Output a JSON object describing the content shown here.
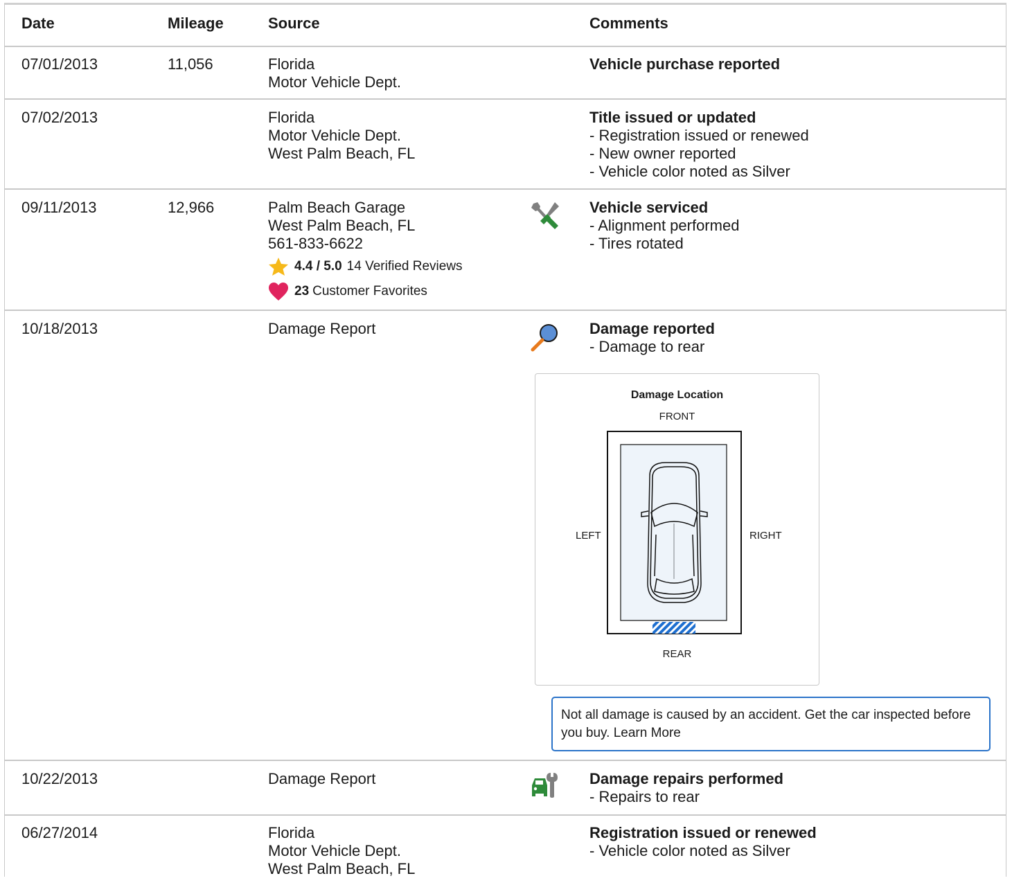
{
  "headers": {
    "date": "Date",
    "mileage": "Mileage",
    "source": "Source",
    "comments": "Comments"
  },
  "rows": [
    {
      "date": "07/01/2013",
      "mileage": "11,056",
      "source": [
        "Florida",
        "Motor Vehicle Dept."
      ],
      "title": "Vehicle purchase reported",
      "items": []
    },
    {
      "date": "07/02/2013",
      "mileage": "",
      "source": [
        "Florida",
        "Motor Vehicle Dept.",
        "West Palm Beach, FL"
      ],
      "title": "Title issued or updated",
      "items": [
        "- Registration issued or renewed",
        "- New owner reported",
        "- Vehicle color noted as Silver"
      ]
    },
    {
      "date": "09/11/2013",
      "mileage": "12,966",
      "source": [
        "Palm Beach Garage",
        "West Palm Beach, FL",
        "561-833-6622"
      ],
      "rating": "4.4 / 5.0",
      "reviews": "14 Verified Reviews",
      "favorites_count": "23",
      "favorites_label": "Customer Favorites",
      "icon": "wrench-screwdriver-icon",
      "title": "Vehicle serviced",
      "items": [
        "- Alignment performed",
        "- Tires rotated"
      ]
    },
    {
      "date": "10/18/2013",
      "mileage": "",
      "source": [
        "Damage Report"
      ],
      "icon": "magnifier-icon",
      "title": "Damage reported",
      "items": [
        "- Damage to rear"
      ]
    },
    {
      "date": "10/22/2013",
      "mileage": "",
      "source": [
        "Damage Report"
      ],
      "icon": "car-repair-icon",
      "title": "Damage repairs performed",
      "items": [
        "- Repairs to rear"
      ]
    },
    {
      "date": "06/27/2014",
      "mileage": "",
      "source": [
        "Florida",
        "Motor Vehicle Dept.",
        "West Palm Beach, FL"
      ],
      "title": "Registration issued or renewed",
      "items": [
        "- Vehicle color noted as Silver"
      ]
    }
  ],
  "damage": {
    "title": "Damage Location",
    "front": "FRONT",
    "rear": "REAR",
    "left": "LEFT",
    "right": "RIGHT",
    "damaged_area": "rear"
  },
  "notice": "Not all damage is caused by an accident. Get the car inspected before you buy. Learn More",
  "colors": {
    "accent": "#2a73c9",
    "star": "#f6b91a",
    "heart": "#e0245e",
    "damage_fill": "#1e6fd0",
    "wrench_green": "#2e8b3a"
  }
}
